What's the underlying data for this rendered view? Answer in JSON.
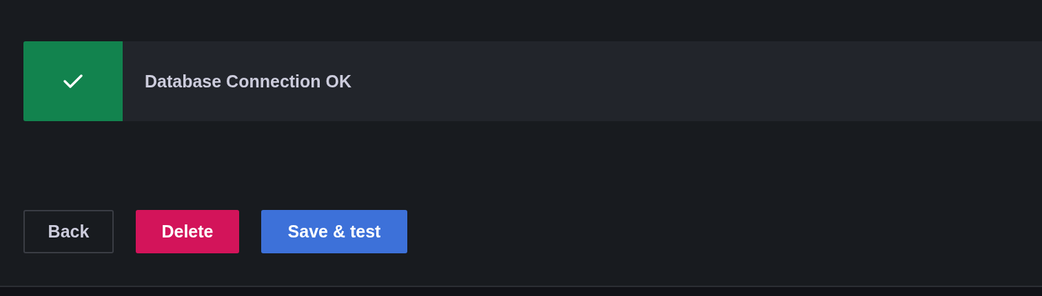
{
  "alert": {
    "kind": "success",
    "message": "Database Connection OK"
  },
  "buttons": [
    {
      "label": "Back",
      "kind": "secondary"
    },
    {
      "label": "Delete",
      "kind": "destructive"
    },
    {
      "label": "Save & test",
      "kind": "primary"
    }
  ]
}
